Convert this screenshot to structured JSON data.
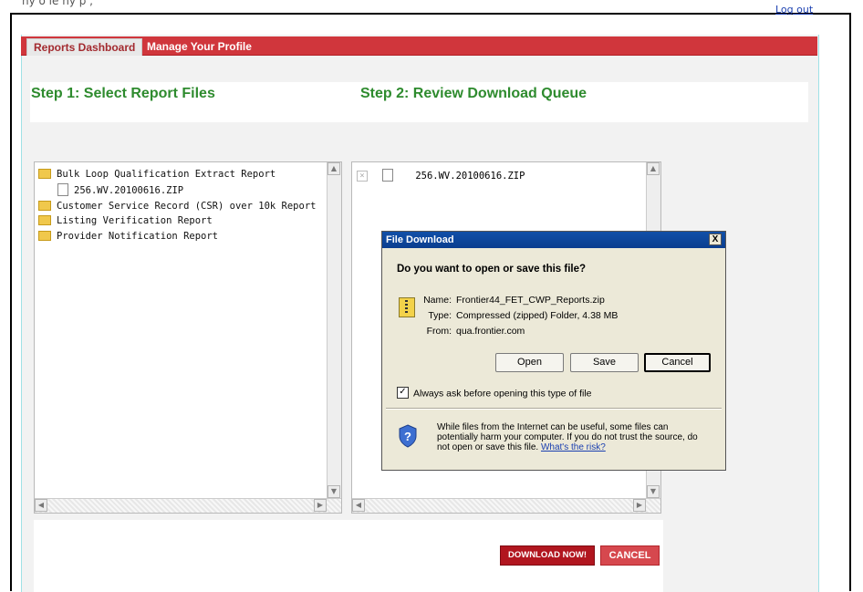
{
  "top": {
    "cut_text": "ny  o     le                        ny           p                              ,",
    "logout": "Log out"
  },
  "tabs": {
    "reports": "Reports Dashboard",
    "profile": "Manage Your Profile"
  },
  "steps": {
    "step1": "Step 1: Select Report Files",
    "step2": "Step 2: Review Download Queue"
  },
  "report_tree": [
    {
      "label": "Bulk Loop Qualification Extract Report",
      "icon": "folder-open-icon"
    },
    {
      "label": "256.WV.20100616.ZIP",
      "icon": "zip-file-icon"
    },
    {
      "label": "Customer Service Record (CSR) over 10k Report",
      "icon": "folder-icon"
    },
    {
      "label": "Listing Verification Report",
      "icon": "folder-icon"
    },
    {
      "label": "Provider Notification Report",
      "icon": "folder-icon"
    }
  ],
  "queue": [
    {
      "label": "256.WV.20100616.ZIP"
    }
  ],
  "buttons": {
    "download_now": "DOWNLOAD NOW!",
    "cancel": "CANCEL"
  },
  "dialog": {
    "title": "File Download",
    "close": "X",
    "question": "Do you want to open or save this file?",
    "name_label": "Name:",
    "name_value": "Frontier44_FET_CWP_Reports.zip",
    "type_label": "Type:",
    "type_value": "Compressed (zipped) Folder, 4.38 MB",
    "from_label": "From:",
    "from_value": "qua.frontier.com",
    "open": "Open",
    "save": "Save",
    "cancel": "Cancel",
    "checkbox_label": "Always ask before opening this type of file",
    "checkbox_checked": true,
    "warning": "While files from the Internet can be useful, some files can potentially harm your computer. If you do not trust the source, do not open or save this file.",
    "risk_link": "What's the risk?"
  }
}
